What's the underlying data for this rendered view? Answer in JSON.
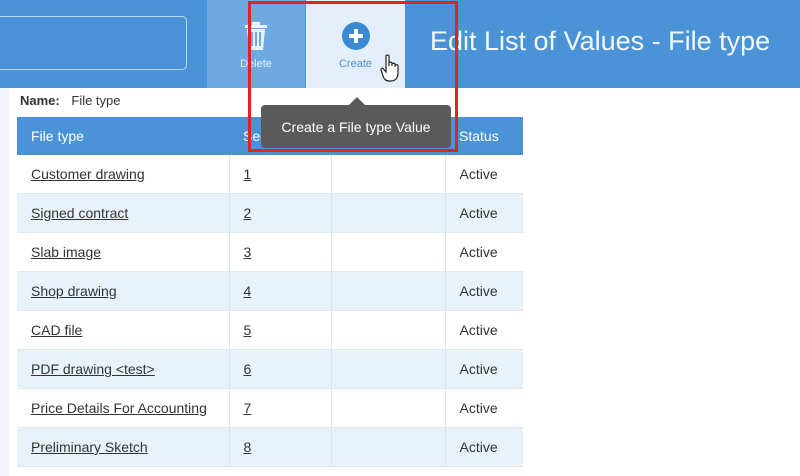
{
  "toolbar": {
    "delete_label": "Delete",
    "create_label": "Create"
  },
  "page_title": "Edit List of Values - File type",
  "tooltip": "Create a File type Value",
  "name_label": "Name:",
  "name_value": "File type",
  "table": {
    "headers": [
      "File type",
      "Seq",
      "",
      "Status"
    ],
    "rows": [
      {
        "file_type": "Customer drawing",
        "seq": "1",
        "status": "Active"
      },
      {
        "file_type": "Signed contract",
        "seq": "2",
        "status": "Active"
      },
      {
        "file_type": "Slab image",
        "seq": "3",
        "status": "Active"
      },
      {
        "file_type": "Shop drawing",
        "seq": "4",
        "status": "Active"
      },
      {
        "file_type": "CAD file",
        "seq": "5",
        "status": "Active"
      },
      {
        "file_type": "PDF drawing <test>",
        "seq": "6",
        "status": "Active"
      },
      {
        "file_type": "Price Details For Accounting",
        "seq": "7",
        "status": "Active"
      },
      {
        "file_type": "Preliminary Sketch",
        "seq": "8",
        "status": "Active"
      }
    ]
  },
  "colors": {
    "accent": "#4a93d6",
    "highlight": "#e02424",
    "tooltip_bg": "#5a5a5a"
  },
  "icons": [
    "trash-icon",
    "plus-circle-icon",
    "hand-cursor-icon"
  ]
}
